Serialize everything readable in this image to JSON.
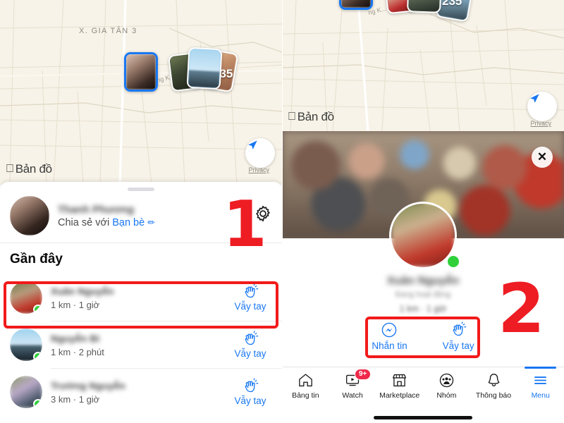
{
  "meta": {
    "app": "Facebook",
    "feature": "Nearby Friends",
    "annotation_color": "#ee1c23",
    "accent_color": "#1877f2",
    "online_color": "#31d03a",
    "badge_color": "#f02849",
    "map_bg": "#f7f3e8"
  },
  "left": {
    "map": {
      "place_label": "X. GIA TÂN 3",
      "street_label": "ng K...",
      "attribution": "Bản đồ",
      "apple_logo": "apple-logo-icon",
      "privacy_link": "Privacy",
      "locate_icon": "navigation-arrow-icon",
      "bubble_overflow_count": "235"
    },
    "sheet": {
      "grabber": "drag-handle",
      "me": {
        "name": "Thanh Phương",
        "share_prefix": "Chia sẻ với ",
        "share_target": "Bạn bè",
        "edit_icon": "pencil-icon",
        "settings_icon": "gear-icon"
      },
      "section_title": "Gần đây",
      "friends": [
        {
          "name": "Xuân Nguyễn",
          "meta": "1 km · 1 giờ",
          "action": "Vẫy tay",
          "online": true,
          "highlighted": true
        },
        {
          "name": "Nguyễn Bi",
          "meta": "1 km · 2 phút",
          "action": "Vẫy tay",
          "online": true,
          "highlighted": false
        },
        {
          "name": "Trường Nguyễn",
          "meta": "3 km · 1 giờ",
          "action": "Vẫy tay",
          "online": true,
          "highlighted": false
        }
      ]
    },
    "annotation": {
      "number": "1"
    }
  },
  "right": {
    "map": {
      "attribution": "Bản đồ",
      "apple_logo": "apple-logo-icon",
      "privacy_link": "Privacy",
      "locate_icon": "navigation-arrow-icon",
      "street_label": "ng K...",
      "bubble_overflow_count": "235"
    },
    "photo": {
      "close_icon": "close-icon"
    },
    "profile": {
      "name": "Xuân Nguyễn",
      "subtitle": "Đang hoạt động",
      "meta": "1 km · 1 giờ",
      "online": true,
      "actions": [
        {
          "label": "Nhắn tin",
          "icon": "messenger-icon"
        },
        {
          "label": "Vẫy tay",
          "icon": "wave-hand-icon"
        }
      ]
    },
    "tabbar": [
      {
        "label": "Bảng tin",
        "icon": "home-icon",
        "badge": "",
        "active": false
      },
      {
        "label": "Watch",
        "icon": "watch-icon",
        "badge": "9+",
        "active": false
      },
      {
        "label": "Marketplace",
        "icon": "store-icon",
        "badge": "",
        "active": false
      },
      {
        "label": "Nhóm",
        "icon": "groups-icon",
        "badge": "",
        "active": false
      },
      {
        "label": "Thông báo",
        "icon": "bell-icon",
        "badge": "",
        "active": false
      },
      {
        "label": "Menu",
        "icon": "hamburger-icon",
        "badge": "",
        "active": true
      }
    ],
    "annotation": {
      "number": "2"
    }
  }
}
